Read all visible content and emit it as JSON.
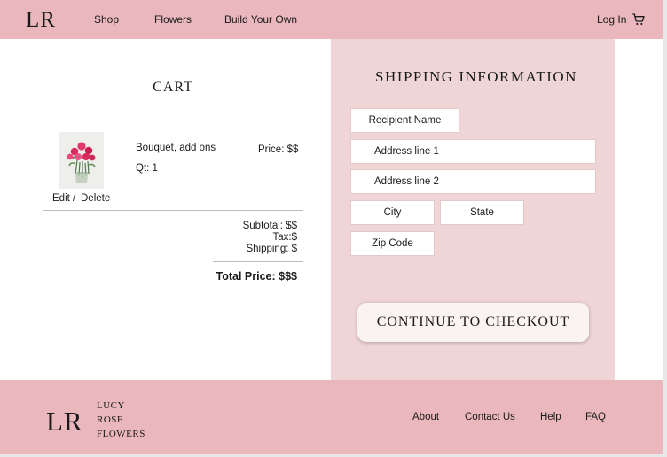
{
  "header": {
    "logo": "LR",
    "nav": [
      "Shop",
      "Flowers",
      "Build Your Own"
    ],
    "login": "Log In",
    "cart_icon": "shopping-cart-icon"
  },
  "cart": {
    "title": "CART",
    "item": {
      "name": "Bouquet, add ons",
      "qty": "Qt: 1",
      "price": "Price: $$",
      "image": "pink-roses-bouquet-photo",
      "edit": "Edit",
      "sep": "/",
      "delete": "Delete"
    },
    "subtotal": "Subtotal: $$",
    "tax": "Tax:$",
    "shipping": "Shipping: $",
    "total": "Total Price: $$$"
  },
  "shipping_info": {
    "title": "SHIPPING INFORMATION",
    "recipient": "Recipient Name",
    "address1": "Address line 1",
    "address2": "Address line 2",
    "city": "City",
    "state": "State",
    "zip": "Zip Code",
    "checkout": "CONTINUE TO CHECKOUT"
  },
  "footer": {
    "logo": "LR",
    "brand_lines": [
      "LUCY",
      "ROSE",
      "FLOWERS"
    ],
    "links": [
      "About",
      "Contact Us",
      "Help",
      "FAQ"
    ]
  },
  "colors": {
    "header_pink": "#e9b7bc",
    "panel_pink": "#efd5d5",
    "button_bg": "#fbf3f2"
  }
}
